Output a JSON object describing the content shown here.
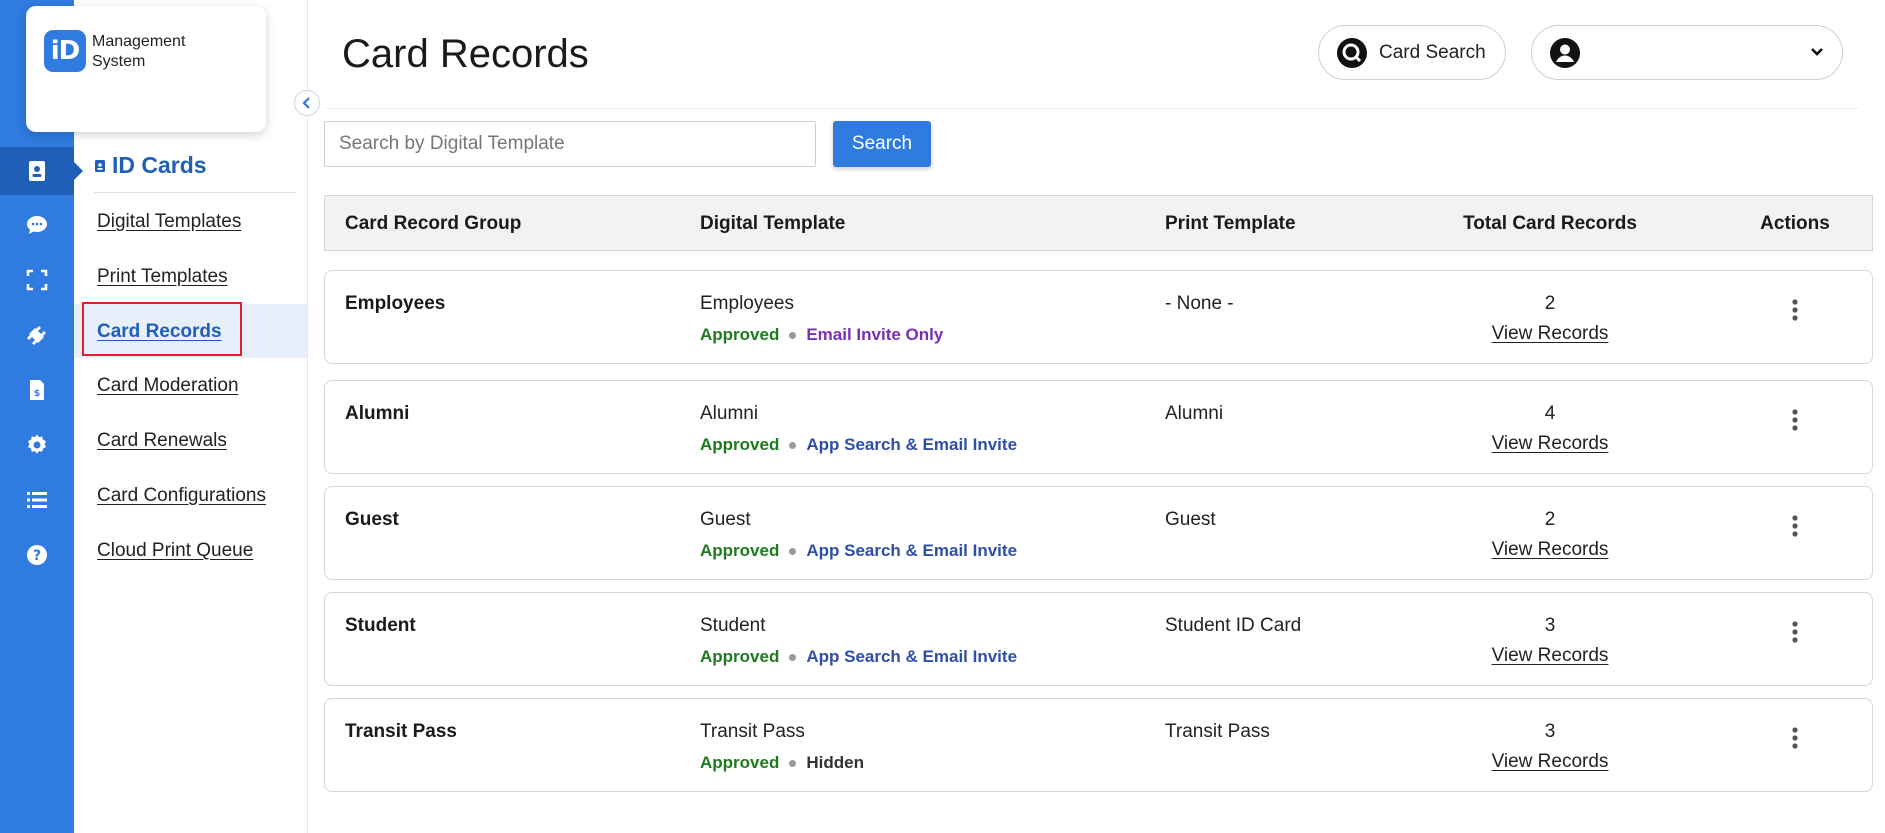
{
  "logo": {
    "badge": "iD",
    "text": "Management System"
  },
  "icons": {
    "rail": [
      "id-card-icon",
      "chat-icon",
      "scan-icon",
      "plugin-icon",
      "invoice-icon",
      "gear-icon",
      "list-icon",
      "help-icon"
    ],
    "collapse": "chevron-left-icon",
    "card_search": "card-search-icon",
    "user": "user-icon",
    "user_chevron": "chevron-down-icon",
    "actions": "kebab-menu-icon"
  },
  "colors": {
    "primary": "#2f7be0",
    "primary_dark": "#1f5fb8",
    "approved": "#1e7a1e",
    "email_invite": "#7a2fb8",
    "app_search": "#2f4ea8",
    "highlight": "#e0202a"
  },
  "sidebar": {
    "title": "ID Cards",
    "items": [
      {
        "label": "Digital Templates"
      },
      {
        "label": "Print Templates"
      },
      {
        "label": "Card Records",
        "active": true
      },
      {
        "label": "Card Moderation"
      },
      {
        "label": "Card Renewals"
      },
      {
        "label": "Card Configurations"
      },
      {
        "label": "Cloud Print Queue"
      }
    ]
  },
  "header": {
    "title": "Card Records",
    "card_search_label": "Card Search",
    "user_name": ""
  },
  "search": {
    "placeholder": "Search by Digital Template",
    "value": "",
    "button_label": "Search"
  },
  "table": {
    "columns": [
      "Card Record Group",
      "Digital Template",
      "Print Template",
      "Total Card Records",
      "Actions"
    ],
    "rows": [
      {
        "group": "Employees",
        "digital_template": "Employees",
        "status": "Approved",
        "access": "Email Invite Only",
        "print_template": "- None -",
        "total": "2",
        "view_label": "View Records"
      },
      {
        "group": "Alumni",
        "digital_template": "Alumni",
        "status": "Approved",
        "access": "App Search & Email Invite",
        "print_template": "Alumni",
        "total": "4",
        "view_label": "View Records"
      },
      {
        "group": "Guest",
        "digital_template": "Guest",
        "status": "Approved",
        "access": "App Search & Email Invite",
        "print_template": "Guest",
        "total": "2",
        "view_label": "View Records"
      },
      {
        "group": "Student",
        "digital_template": "Student",
        "status": "Approved",
        "access": "App Search & Email Invite",
        "print_template": "Student ID Card",
        "total": "3",
        "view_label": "View Records"
      },
      {
        "group": "Transit Pass",
        "digital_template": "Transit Pass",
        "status": "Approved",
        "access": "Hidden",
        "print_template": "Transit Pass",
        "total": "3",
        "view_label": "View Records"
      }
    ]
  }
}
